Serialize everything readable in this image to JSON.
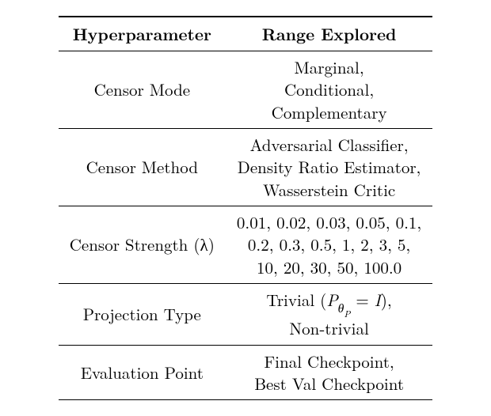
{
  "table": {
    "headers": {
      "col1": "Hyperparameter",
      "col2": "Range Explored"
    },
    "rows": [
      {
        "param": "Censor Mode",
        "range": "Marginal,\nConditional,\nComplementary"
      },
      {
        "param": "Censor Method",
        "range": "Adversarial Classifier,\nDensity Ratio Estimator,\nWasserstein Critic"
      },
      {
        "param": "Censor Strength (λ)",
        "range": "0.01, 0.02, 0.03, 0.05, 0.1,\n0.2, 0.3, 0.5, 1, 2, 3, 5,\n10, 20, 30, 50, 100.0"
      },
      {
        "param": "Projection Type",
        "range_html": "Trivial (<span class=\"ital\">P</span><span class=\"sub ital\">θ<span class=\"sub\">P</span></span> = <span class=\"ital\">I</span>),<br>Non-trivial"
      },
      {
        "param": "Evaluation Point",
        "range": "Final Checkpoint,\nBest Val Checkpoint"
      }
    ]
  }
}
